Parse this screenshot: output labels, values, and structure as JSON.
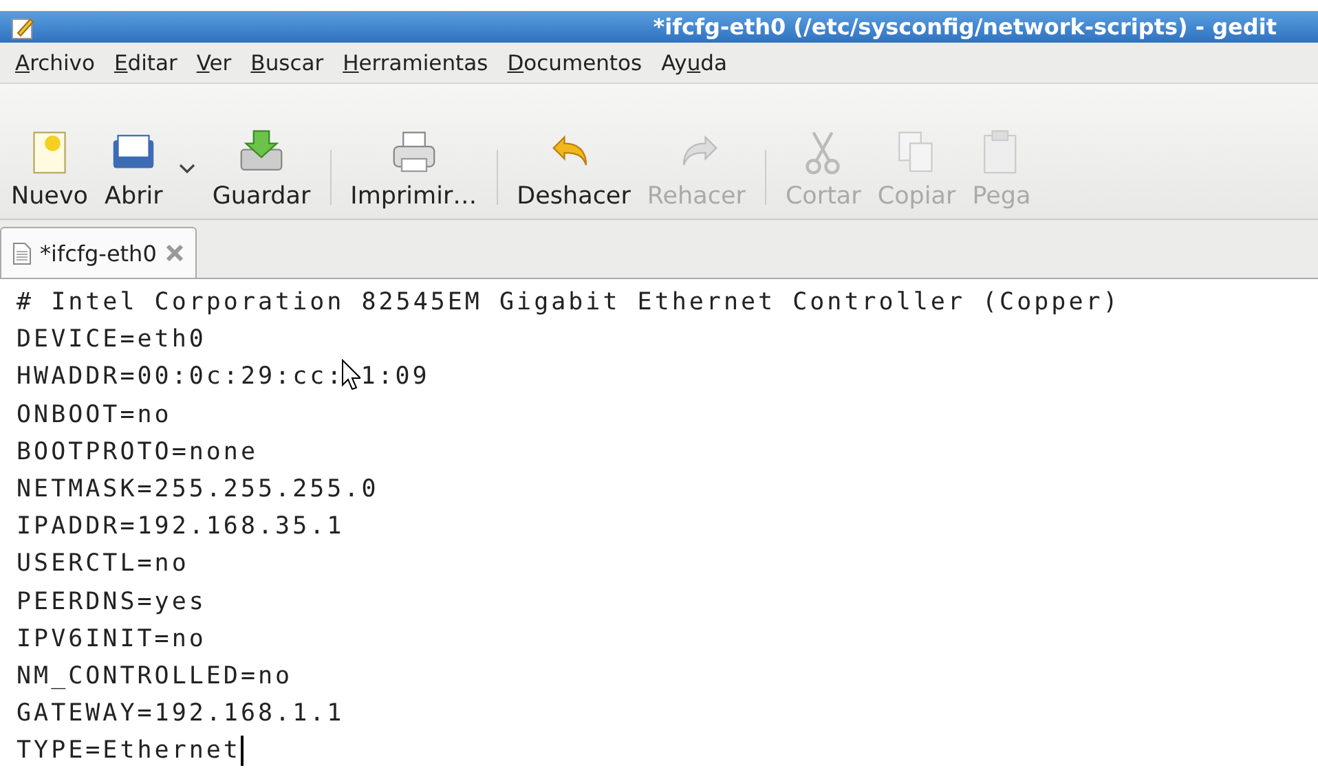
{
  "window": {
    "title": "*ifcfg-eth0 (/etc/sysconfig/network-scripts) - gedit"
  },
  "menu": [
    {
      "key": "A",
      "after": "rchivo"
    },
    {
      "key": "E",
      "after": "ditar"
    },
    {
      "key": "V",
      "after": "er"
    },
    {
      "key": "B",
      "after": "uscar"
    },
    {
      "key": "H",
      "after": "erramientas"
    },
    {
      "key": "D",
      "after": "ocumentos"
    },
    {
      "before": "Ay",
      "key": "u",
      "after": "da"
    }
  ],
  "toolbar": [
    {
      "kind": "new",
      "label": "Nuevo",
      "disabled": false
    },
    {
      "kind": "open",
      "label": "Abrir",
      "disabled": false
    },
    {
      "kind": "dropdown"
    },
    {
      "kind": "save",
      "label": "Guardar",
      "disabled": false
    },
    {
      "kind": "separator"
    },
    {
      "kind": "print",
      "label": "Imprimir…",
      "disabled": false
    },
    {
      "kind": "separator"
    },
    {
      "kind": "undo",
      "label": "Deshacer",
      "disabled": false
    },
    {
      "kind": "redo",
      "label": "Rehacer",
      "disabled": true
    },
    {
      "kind": "separator"
    },
    {
      "kind": "cut",
      "label": "Cortar",
      "disabled": true
    },
    {
      "kind": "copy",
      "label": "Copiar",
      "disabled": true
    },
    {
      "kind": "paste",
      "label": "Pega",
      "disabled": true
    }
  ],
  "tabs": [
    {
      "label": "*ifcfg-eth0",
      "selected": true
    }
  ],
  "editor": {
    "lines": [
      {
        "text": "# Intel Corporation 82545EM Gigabit Ethernet Controller (Copper)"
      },
      {
        "text": "DEVICE=eth0"
      },
      {
        "text": "HWADDR=00:0c:29:cc:",
        "after_cursor": "1:09"
      },
      {
        "text": "ONBOOT=no"
      },
      {
        "text": "BOOTPROTO=none"
      },
      {
        "text": "NETMASK=255.255.255.0"
      },
      {
        "text": "IPADDR=192.168.35.1"
      },
      {
        "text": "USERCTL=no"
      },
      {
        "text": "PEERDNS=yes"
      },
      {
        "text": "IPV6INIT=no"
      },
      {
        "text": "NM_CONTROLLED=no"
      },
      {
        "text": "GATEWAY=192.168.1.1"
      },
      {
        "text": "TYPE=Ethernet",
        "caret": true
      }
    ]
  }
}
